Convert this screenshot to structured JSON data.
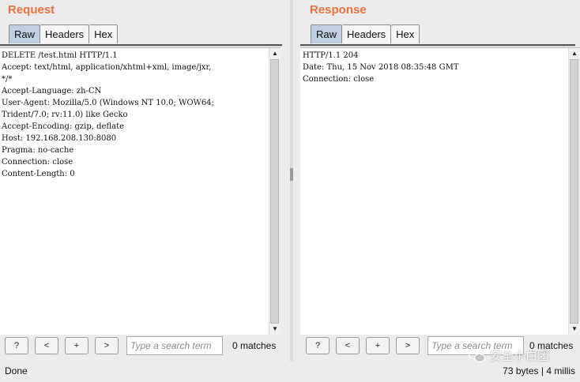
{
  "request": {
    "title": "Request",
    "tabs": [
      "Raw",
      "Headers",
      "Hex"
    ],
    "active_tab": "Raw",
    "content": "DELETE /test.html HTTP/1.1\nAccept: text/html, application/xhtml+xml, image/jxr,\n*/*\nAccept-Language: zh-CN\nUser-Agent: Mozilla/5.0 (Windows NT 10.0; WOW64;\nTrident/7.0; rv:11.0) like Gecko\nAccept-Encoding: gzip, deflate\nHost: 192.168.208.130:8080\nPragma: no-cache\nConnection: close\nContent-Length: 0",
    "search": {
      "help_label": "?",
      "prev_label": "<",
      "next_label": "+",
      "forward_label": ">",
      "placeholder": "Type a search term",
      "matches": "0 matches"
    }
  },
  "response": {
    "title": "Response",
    "tabs": [
      "Raw",
      "Headers",
      "Hex"
    ],
    "active_tab": "Raw",
    "content": "HTTP/1.1 204\nDate: Thu, 15 Nov 2018 08:35:48 GMT\nConnection: close",
    "search": {
      "help_label": "?",
      "prev_label": "<",
      "next_label": "+",
      "forward_label": ">",
      "placeholder": "Type a search term",
      "matches": "0 matches"
    }
  },
  "status": {
    "left": "Done",
    "right": "73 bytes | 4 millis"
  },
  "watermark": {
    "text": "安全小白团",
    "icon": "wechat-icon"
  },
  "colors": {
    "title": "#e8733e",
    "active_tab": "#bfcfe0"
  }
}
